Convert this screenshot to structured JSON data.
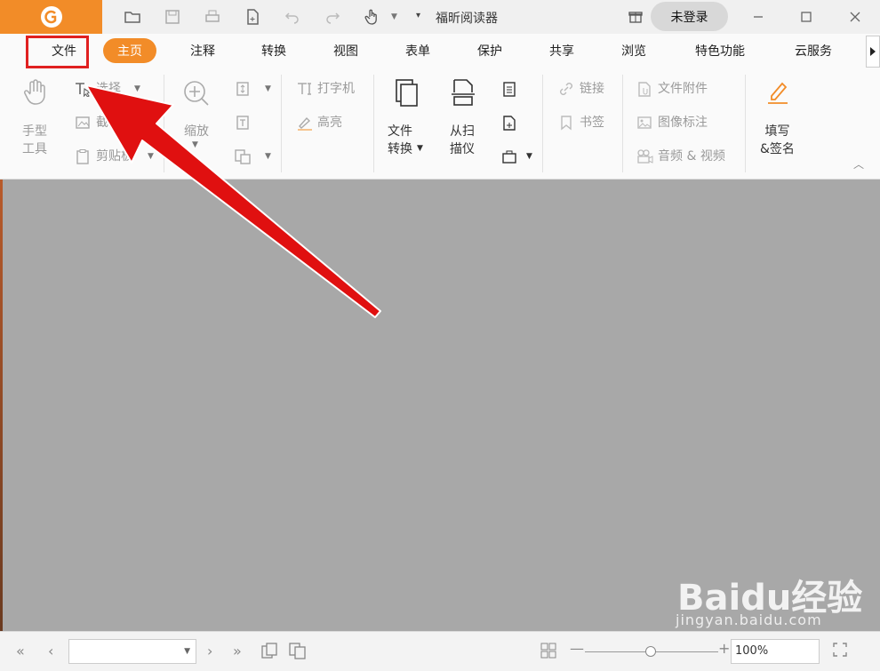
{
  "app": {
    "title": "福昕阅读器",
    "login_label": "未登录"
  },
  "tabs": [
    {
      "label": "文件"
    },
    {
      "label": "主页"
    },
    {
      "label": "注释"
    },
    {
      "label": "转换"
    },
    {
      "label": "视图"
    },
    {
      "label": "表单"
    },
    {
      "label": "保护"
    },
    {
      "label": "共享"
    },
    {
      "label": "浏览"
    },
    {
      "label": "特色功能"
    },
    {
      "label": "云服务"
    }
  ],
  "ribbon": {
    "hand_tool": "手型\n工具",
    "select": "选择",
    "snapshot": "截图",
    "clipboard": "剪贴板",
    "zoom": "缩放",
    "typewriter": "打字机",
    "highlight": "高亮",
    "file_convert": "文件\n转换",
    "from_scanner": "从扫\n描仪",
    "link": "链接",
    "bookmark": "书签",
    "file_attachment": "文件附件",
    "image_annotation": "图像标注",
    "audio_video": "音频 & 视频",
    "fill_sign": "填写\n&签名"
  },
  "status": {
    "zoom_value": "100%"
  },
  "watermark": {
    "main": "Baidu经验",
    "sub": "jingyan.baidu.com"
  },
  "colors": {
    "accent": "#f28c28",
    "highlight_box": "#e02020",
    "arrow": "#e01010"
  }
}
